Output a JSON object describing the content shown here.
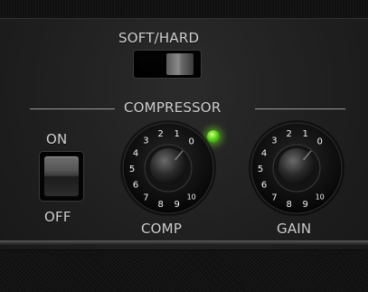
{
  "controls": {
    "soft_hard": {
      "label": "SOFT/HARD",
      "position": "hard"
    },
    "section_title": "COMPRESSOR",
    "power": {
      "on_label": "ON",
      "off_label": "OFF",
      "state": "on"
    },
    "led": {
      "color": "#5fd61b",
      "lit": true
    },
    "comp_knob": {
      "label": "COMP",
      "value": 0
    },
    "gain_knob": {
      "label": "GAIN",
      "value": 0
    },
    "dial_scale": [
      "0",
      "1",
      "2",
      "3",
      "4",
      "5",
      "6",
      "7",
      "8",
      "9",
      "10"
    ]
  }
}
